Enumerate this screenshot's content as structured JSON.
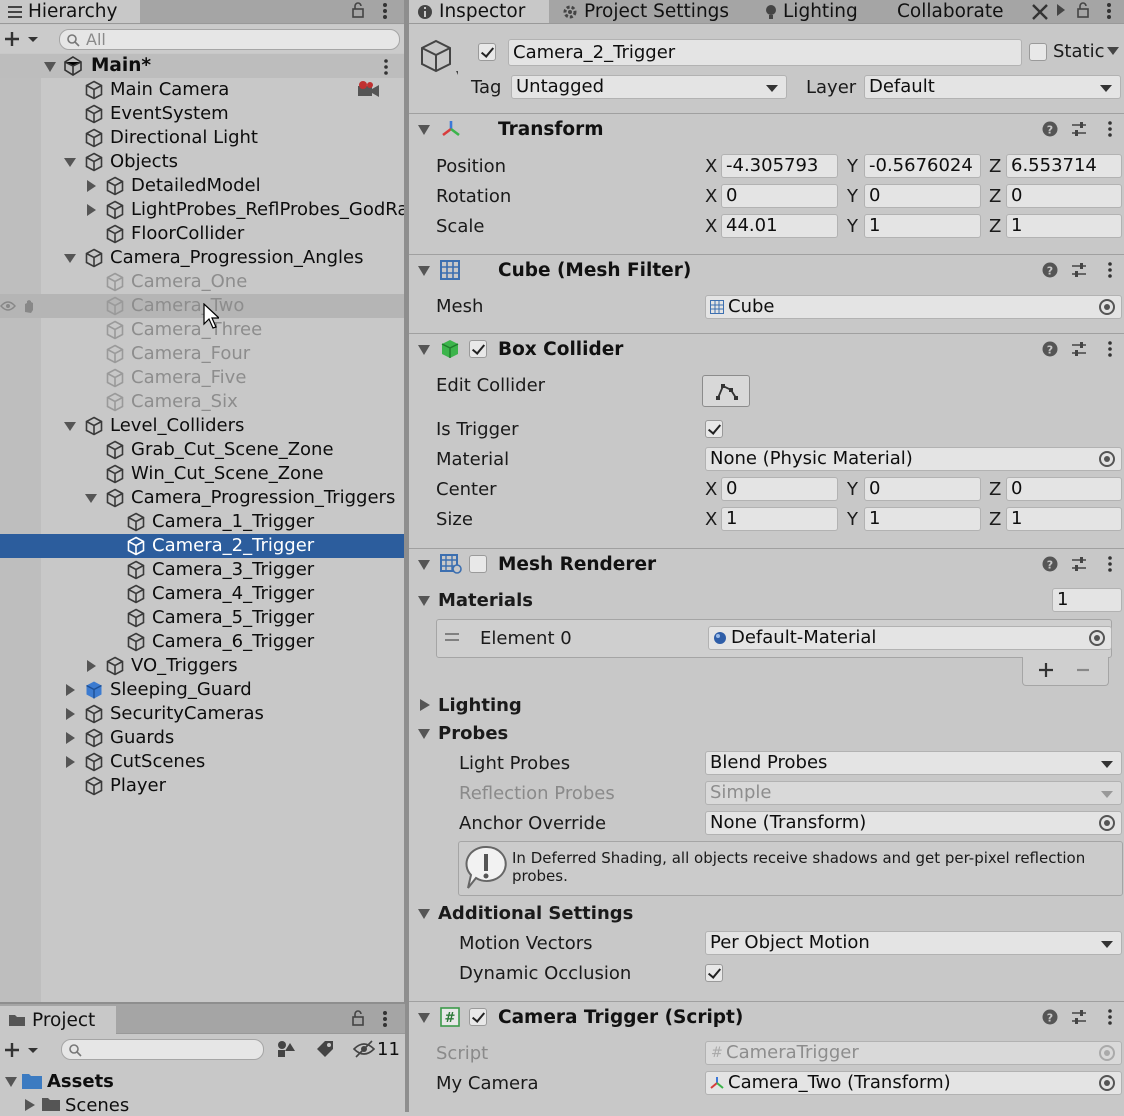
{
  "hierarchy": {
    "tab_label": "Hierarchy",
    "search_placeholder": "All",
    "scene_name": "Main*",
    "items": [
      {
        "label": "Main Camera"
      },
      {
        "label": "EventSystem"
      },
      {
        "label": "Directional Light"
      },
      {
        "label": "Objects"
      },
      {
        "label": "DetailedModel"
      },
      {
        "label": "LightProbes_ReflProbes_GodRa"
      },
      {
        "label": "FloorCollider"
      },
      {
        "label": "Camera_Progression_Angles"
      },
      {
        "label": "Camera_One"
      },
      {
        "label": "Camera_Two"
      },
      {
        "label": "Camera_Three"
      },
      {
        "label": "Camera_Four"
      },
      {
        "label": "Camera_Five"
      },
      {
        "label": "Camera_Six"
      },
      {
        "label": "Level_Colliders"
      },
      {
        "label": "Grab_Cut_Scene_Zone"
      },
      {
        "label": "Win_Cut_Scene_Zone"
      },
      {
        "label": "Camera_Progression_Triggers"
      },
      {
        "label": "Camera_1_Trigger"
      },
      {
        "label": "Camera_2_Trigger"
      },
      {
        "label": "Camera_3_Trigger"
      },
      {
        "label": "Camera_4_Trigger"
      },
      {
        "label": "Camera_5_Trigger"
      },
      {
        "label": "Camera_6_Trigger"
      },
      {
        "label": "VO_Triggers"
      },
      {
        "label": "Sleeping_Guard"
      },
      {
        "label": "SecurityCameras"
      },
      {
        "label": "Guards"
      },
      {
        "label": "CutScenes"
      },
      {
        "label": "Player"
      }
    ]
  },
  "project": {
    "tab_label": "Project",
    "hidden_count": "11",
    "tree": [
      {
        "label": "Assets"
      },
      {
        "label": "Scenes"
      }
    ]
  },
  "inspector_tabs": [
    "Inspector",
    "Project Settings",
    "Lighting",
    "Collaborate"
  ],
  "object": {
    "name": "Camera_2_Trigger",
    "static_label": "Static",
    "tag_label": "Tag",
    "tag_value": "Untagged",
    "layer_label": "Layer",
    "layer_value": "Default"
  },
  "transform": {
    "title": "Transform",
    "rows": [
      {
        "label": "Position",
        "x": "-4.305793",
        "y": "-0.5676024",
        "z": "6.553714"
      },
      {
        "label": "Rotation",
        "x": "0",
        "y": "0",
        "z": "0"
      },
      {
        "label": "Scale",
        "x": "44.01",
        "y": "1",
        "z": "1"
      }
    ]
  },
  "mesh_filter": {
    "title": "Cube (Mesh Filter)",
    "mesh_label": "Mesh",
    "mesh_value": "Cube"
  },
  "box_collider": {
    "title": "Box Collider",
    "edit_label": "Edit Collider",
    "is_trigger_label": "Is Trigger",
    "material_label": "Material",
    "material_value": "None (Physic Material)",
    "center_label": "Center",
    "center": {
      "x": "0",
      "y": "0",
      "z": "0"
    },
    "size_label": "Size",
    "size": {
      "x": "1",
      "y": "1",
      "z": "1"
    }
  },
  "mesh_renderer": {
    "title": "Mesh Renderer",
    "materials_label": "Materials",
    "materials_count": "1",
    "element_label": "Element 0",
    "element_value": "Default-Material",
    "lighting_label": "Lighting",
    "probes_label": "Probes",
    "light_probes_label": "Light Probes",
    "light_probes_value": "Blend Probes",
    "reflection_probes_label": "Reflection Probes",
    "reflection_probes_value": "Simple",
    "anchor_label": "Anchor Override",
    "anchor_value": "None (Transform)",
    "info_text": "In Deferred Shading, all objects receive shadows and get per-pixel reflection probes.",
    "additional_label": "Additional Settings",
    "motion_label": "Motion Vectors",
    "motion_value": "Per Object Motion",
    "occlusion_label": "Dynamic Occlusion"
  },
  "camera_trigger": {
    "title": "Camera Trigger (Script)",
    "script_label": "Script",
    "script_value": "CameraTrigger",
    "camera_label": "My Camera",
    "camera_value": "Camera_Two (Transform)"
  },
  "axis": {
    "x": "X",
    "y": "Y",
    "z": "Z"
  },
  "colors": {
    "selection": "#2c5d9d",
    "panel": "#c8c8c8",
    "tab_active": "#c8c8c8"
  }
}
